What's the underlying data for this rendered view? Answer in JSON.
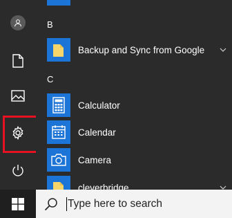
{
  "rail": {
    "items": [
      {
        "icon": "user-icon"
      },
      {
        "icon": "document-icon"
      },
      {
        "icon": "pictures-icon"
      },
      {
        "icon": "settings-gear-icon"
      },
      {
        "icon": "power-icon"
      }
    ]
  },
  "apps": {
    "sections": [
      {
        "letter": "B",
        "items": [
          {
            "name": "Backup and Sync from Google",
            "expandable": true
          }
        ]
      },
      {
        "letter": "C",
        "items": [
          {
            "name": "Calculator",
            "expandable": false
          },
          {
            "name": "Calendar",
            "expandable": false
          },
          {
            "name": "Camera",
            "expandable": false
          },
          {
            "name": "cleverbridge",
            "expandable": true
          }
        ]
      }
    ]
  },
  "taskbar": {
    "search_placeholder": "Type here to search"
  },
  "colors": {
    "tile_blue": "#1b74d6",
    "highlight_red": "#e81123",
    "background": "#2b2b2b"
  }
}
